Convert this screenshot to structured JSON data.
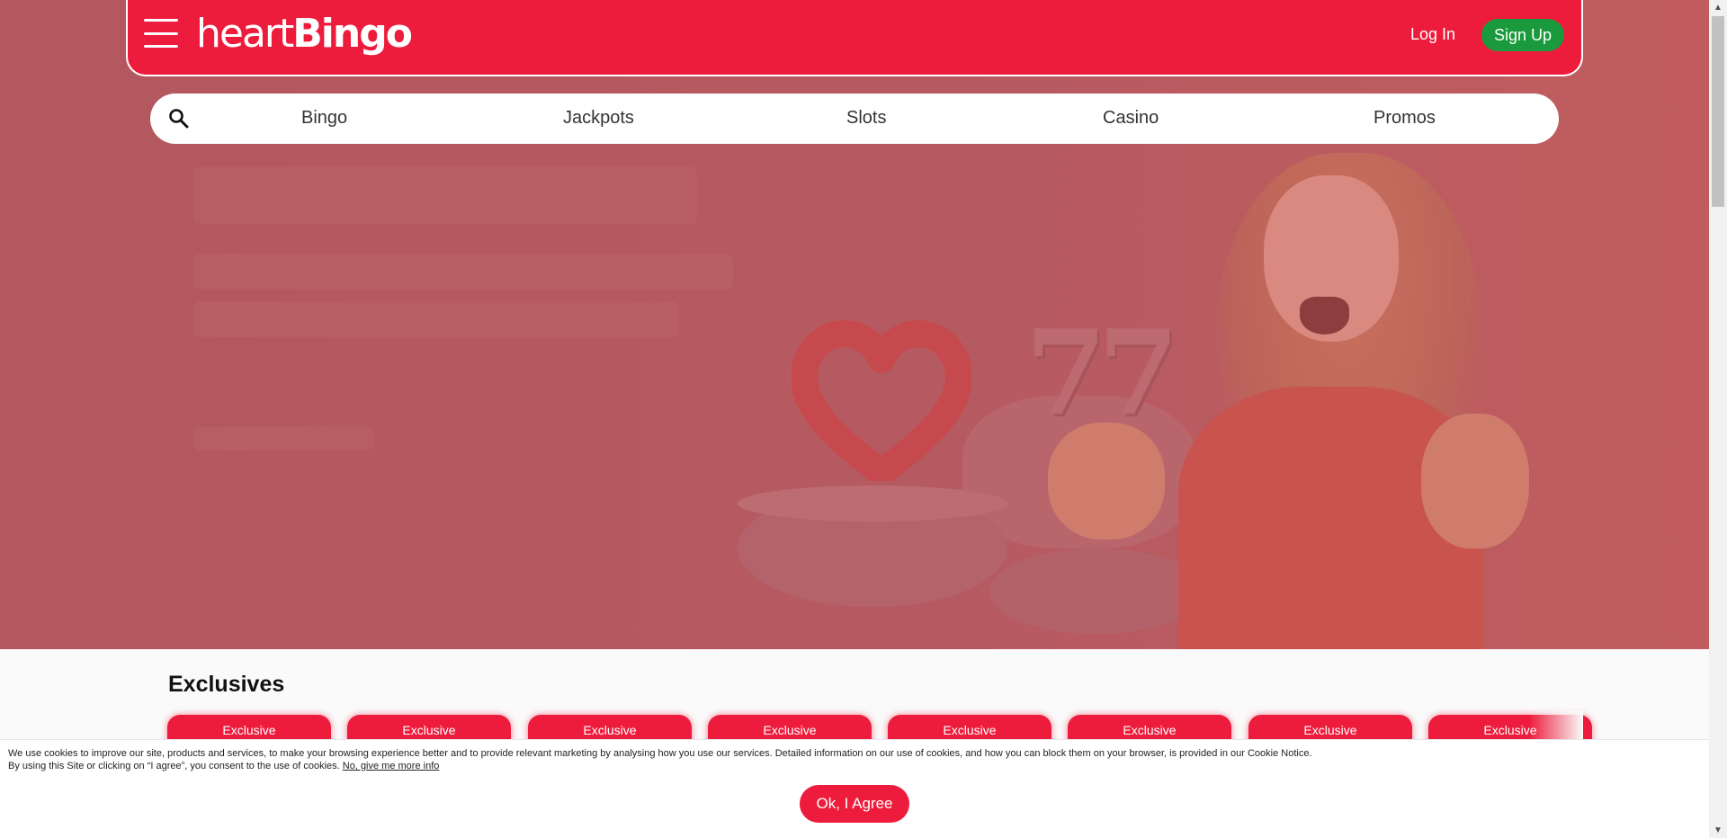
{
  "header": {
    "logo_text_a": "heart",
    "logo_text_b": "Bingo",
    "login_label": "Log In",
    "signup_label": "Sign Up"
  },
  "nav": {
    "items": [
      {
        "label": "Bingo"
      },
      {
        "label": "Jackpots"
      },
      {
        "label": "Slots"
      },
      {
        "label": "Casino"
      },
      {
        "label": "Promos"
      }
    ]
  },
  "exclusives": {
    "title": "Exclusives",
    "badges": [
      "Exclusive",
      "Exclusive",
      "Exclusive",
      "Exclusive",
      "Exclusive",
      "Exclusive",
      "Exclusive",
      "Exclusive"
    ]
  },
  "cookie": {
    "line1": "We use cookies to improve our site, products and services, to make your browsing experience better and to provide relevant marketing by analysing how you use our services. Detailed information on our use of cookies, and how you can block them on your browser, is provided in our Cookie Notice.",
    "line2": "By using this Site or clicking on “I agree”, you consent to the use of cookies.",
    "more_info_link": "No, give me more info",
    "agree_label": "Ok, I Agree"
  },
  "colors": {
    "brand_red": "#ed1c3c",
    "signup_green": "#1a9a3c",
    "hero_overlay": "#b4585f"
  },
  "icons": {
    "menu": "hamburger-menu-icon",
    "search": "search-icon"
  }
}
